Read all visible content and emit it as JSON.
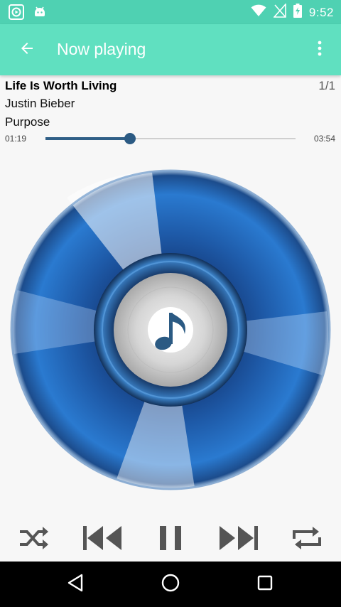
{
  "status_bar": {
    "time": "9:52",
    "icons": [
      "app-notification-icon",
      "android-icon",
      "wifi-icon",
      "no-sim-icon",
      "battery-charging-icon"
    ]
  },
  "app_bar": {
    "title": "Now playing",
    "back_icon": "arrow-back-icon",
    "overflow_icon": "more-vert-icon",
    "background": "#60e0c0"
  },
  "track": {
    "title": "Life Is Worth Living",
    "artist": "Justin Bieber",
    "album": "Purpose",
    "position": "1/1",
    "elapsed": "01:19",
    "duration": "03:54",
    "progress": 0.337
  },
  "artwork": {
    "icon": "music-note-icon"
  },
  "controls": [
    {
      "name": "shuffle-button",
      "icon": "shuffle-icon"
    },
    {
      "name": "previous-button",
      "icon": "skip-previous-icon"
    },
    {
      "name": "pause-button",
      "icon": "pause-icon"
    },
    {
      "name": "next-button",
      "icon": "skip-next-icon"
    },
    {
      "name": "repeat-button",
      "icon": "repeat-icon"
    }
  ],
  "nav_bar": {
    "icons": [
      "back-triangle-icon",
      "home-circle-icon",
      "recents-square-icon"
    ]
  },
  "colors": {
    "status_bar": "#4fd1b2",
    "accent": "#2b5a83",
    "control_icon": "#555555"
  }
}
